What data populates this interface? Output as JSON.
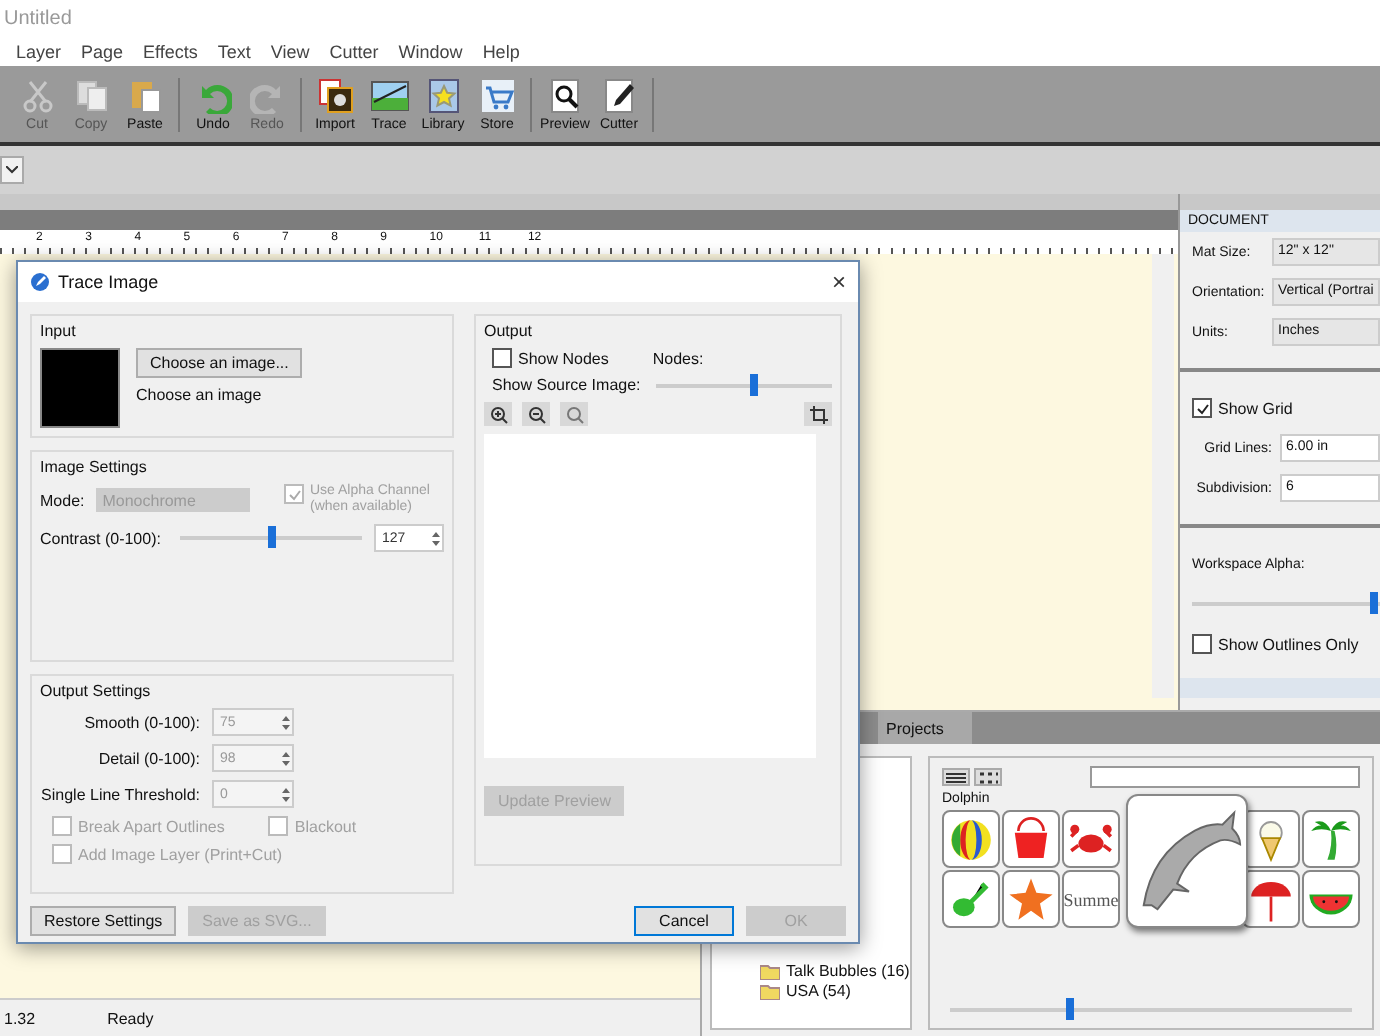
{
  "window": {
    "title": "Untitled"
  },
  "menu": [
    "Layer",
    "Page",
    "Effects",
    "Text",
    "View",
    "Cutter",
    "Window",
    "Help"
  ],
  "toolbar": [
    [
      {
        "label": "Cut",
        "kind": "cut",
        "disabled": true
      },
      {
        "label": "Copy",
        "kind": "copy",
        "disabled": true
      },
      {
        "label": "Paste",
        "kind": "paste",
        "disabled": false
      }
    ],
    [
      {
        "label": "Undo",
        "kind": "undo",
        "disabled": false
      },
      {
        "label": "Redo",
        "kind": "redo",
        "disabled": true
      }
    ],
    [
      {
        "label": "Import",
        "kind": "import",
        "disabled": false
      },
      {
        "label": "Trace",
        "kind": "trace",
        "disabled": false
      },
      {
        "label": "Library",
        "kind": "library",
        "disabled": false
      },
      {
        "label": "Store",
        "kind": "store",
        "disabled": false
      }
    ],
    [
      {
        "label": "Preview",
        "kind": "preview",
        "disabled": false
      },
      {
        "label": "Cutter",
        "kind": "cutter",
        "disabled": false
      }
    ]
  ],
  "ruler": [
    "2",
    "3",
    "4",
    "5",
    "6",
    "7",
    "8",
    "9",
    "10",
    "11",
    "12"
  ],
  "document_panel": {
    "title": "DOCUMENT",
    "fields": [
      {
        "label": "Mat Size:",
        "value": "12\" x 12\""
      },
      {
        "label": "Orientation:",
        "value": "Vertical (Portrai"
      },
      {
        "label": "Units:",
        "value": "Inches"
      }
    ],
    "show_grid": {
      "label": "Show Grid",
      "checked": true
    },
    "grid_fields": [
      {
        "label": "Grid Lines:",
        "value": "6.00 in"
      },
      {
        "label": "Subdivision:",
        "value": "6"
      }
    ],
    "workspace_alpha": {
      "label": "Workspace Alpha:",
      "level": 0.97
    },
    "show_outlines": {
      "label": "Show Outlines Only",
      "checked": false
    }
  },
  "status_bar": {
    "zoom": "1.32",
    "message": "Ready"
  },
  "trace_dialog": {
    "title": "Trace Image",
    "close": "×",
    "input": {
      "title": "Input",
      "button": "Choose an image...",
      "note": "Choose an image"
    },
    "image_settings": {
      "title": "Image Settings",
      "mode_label": "Mode:",
      "mode": "Monochrome",
      "alpha": {
        "label": "Use Alpha Channel (when available)",
        "checked": true,
        "disabled": true
      },
      "contrast_label": "Contrast (0-100):",
      "contrast": {
        "level": 0.5,
        "value": "127"
      }
    },
    "output_settings": {
      "title": "Output Settings",
      "fields": [
        {
          "label": "Smooth (0-100):",
          "value": "75"
        },
        {
          "label": "Detail (0-100):",
          "value": "98"
        },
        {
          "label": "Single Line Threshold:",
          "value": "0"
        }
      ],
      "options": [
        {
          "label": "Break Apart Outlines",
          "checked": false,
          "disabled": true
        },
        {
          "label": "Blackout",
          "checked": false,
          "disabled": true
        },
        {
          "label": "Add Image Layer (Print+Cut)",
          "checked": false,
          "disabled": true
        }
      ]
    },
    "output": {
      "title": "Output",
      "show_nodes": {
        "label": "Show Nodes",
        "checked": false
      },
      "nodes_label": "Nodes:",
      "source_label": "Show Source Image:",
      "source": {
        "level": 0.55
      },
      "update": {
        "label": "Update Preview",
        "disabled": true
      }
    },
    "buttons": [
      {
        "label": "Restore Settings",
        "disabled": false
      },
      {
        "label": "Save as SVG...",
        "disabled": true
      }
    ],
    "actions": [
      {
        "label": "Cancel",
        "disabled": false,
        "focused": true
      },
      {
        "label": "OK",
        "disabled": true,
        "focused": false
      }
    ]
  },
  "library": {
    "tabs": [
      {
        "label": "Projects",
        "selected": false
      }
    ],
    "tree": [
      "Talk Bubbles (16)",
      "USA (54)"
    ],
    "caption": "Dolphin",
    "items": [
      {
        "kind": "ball"
      },
      {
        "kind": "bucket"
      },
      {
        "kind": "crab"
      },
      {
        "kind": "dolphin"
      },
      {
        "kind": "icecream"
      },
      {
        "kind": "palm"
      },
      {
        "kind": "shovel"
      },
      {
        "kind": "star"
      },
      {
        "kind": "word",
        "label": "Summe"
      },
      {
        "kind": "umbrella"
      },
      {
        "kind": "watermelon"
      }
    ],
    "size": {
      "level": 0.3
    }
  }
}
